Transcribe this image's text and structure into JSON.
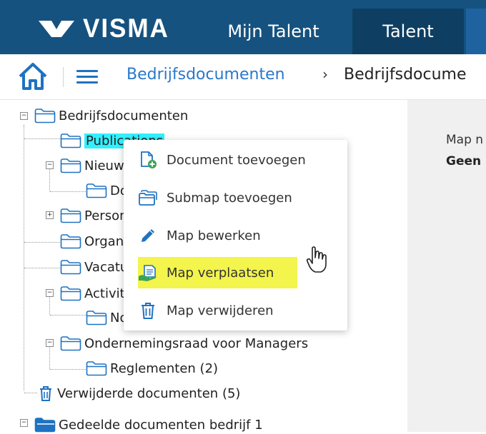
{
  "brand": {
    "name": "VISMA"
  },
  "topnav": {
    "tabs": [
      {
        "label": "Mijn Talent"
      },
      {
        "label": "Talent"
      }
    ]
  },
  "breadcrumb": {
    "items": [
      "Bedrijfsdocumenten",
      "Bedrijfsdocume"
    ],
    "separator": "›"
  },
  "tree": {
    "root": "Bedrijfsdocumenten",
    "nodes": {
      "publications": "Publications",
      "nieuws": "Nieuwsbrieven",
      "docs": "Documenten",
      "personeel": "Personeel",
      "organisatie": "Organisatie",
      "vacatures": "Vacatures",
      "activiteiten": "Activiteiten",
      "notulen": "Notulen",
      "or": "Ondernemingsraad voor Managers",
      "reglementen": "Reglementen (2)",
      "deleted": "Verwijderde documenten (5)",
      "shared": "Gedeelde documenten bedrijf 1"
    }
  },
  "context_menu": {
    "items": [
      {
        "label": "Document toevoegen",
        "icon": "document-add-icon"
      },
      {
        "label": "Submap toevoegen",
        "icon": "folder-add-icon"
      },
      {
        "label": "Map bewerken",
        "icon": "pencil-icon"
      },
      {
        "label": "Map verplaatsen",
        "icon": "move-folder-icon",
        "highlighted": true
      },
      {
        "label": "Map verwijderen",
        "icon": "trash-icon"
      }
    ]
  },
  "detail": {
    "line1": "Map n",
    "line2": "Geen"
  },
  "colors": {
    "header": "#16527f",
    "active_tab": "#0e3f63",
    "link": "#2b78c8",
    "highlight": "#f3f44c",
    "selection": "#33f0ff",
    "icon_blue": "#1f72c1",
    "icon_green": "#3aa35a"
  }
}
